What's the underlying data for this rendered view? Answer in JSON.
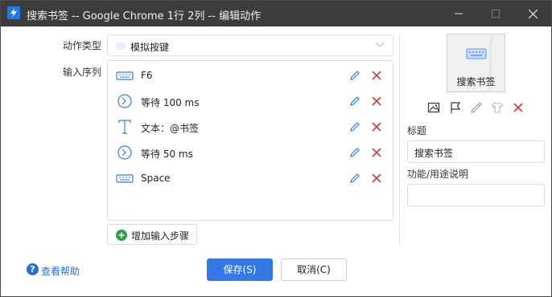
{
  "window": {
    "title": "搜索书签 -- Google Chrome 1行 2列 -- 编辑动作"
  },
  "form": {
    "action_type_label": "动作类型",
    "action_type_value": "模拟按键",
    "input_sequence_label": "输入序列"
  },
  "sequence": [
    {
      "icon": "keyboard-icon",
      "text": "F6"
    },
    {
      "icon": "clock-icon",
      "text": "等待 100 ms"
    },
    {
      "icon": "text-icon",
      "text": "文本：@书签"
    },
    {
      "icon": "clock-icon",
      "text": "等待 50 ms"
    },
    {
      "icon": "keyboard-icon",
      "text": "Space"
    }
  ],
  "add_step_label": "增加输入步骤",
  "preview": {
    "label": "搜索书签"
  },
  "fields": {
    "title_label": "标题",
    "title_value": "搜索书签",
    "description_label": "功能/用途说明",
    "description_value": ""
  },
  "footer": {
    "help_label": "查看帮助",
    "save_label": "保存(S)",
    "cancel_label": "取消(C)"
  },
  "colors": {
    "titlebar": "#3c3c3c",
    "primary": "#3478e5",
    "edit_icon": "#3a7be0",
    "delete_icon": "#e03c3c",
    "add_icon": "#2e9e4f",
    "help": "#2a6fd6"
  }
}
